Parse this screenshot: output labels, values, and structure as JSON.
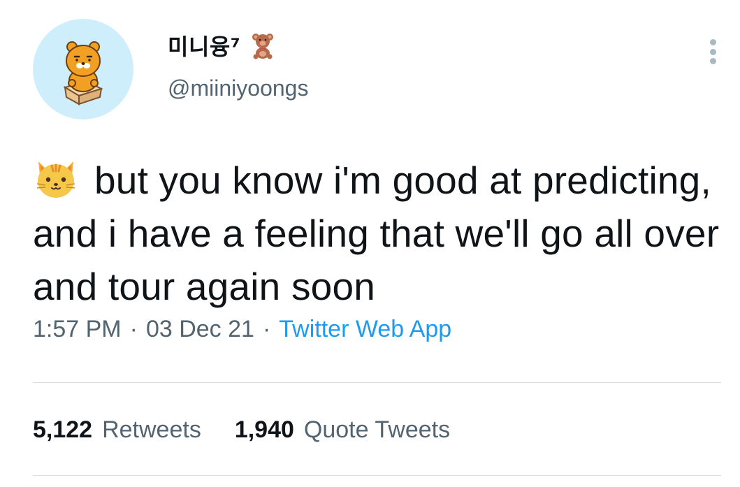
{
  "author": {
    "display_name": "미니융⁷",
    "badge_emoji": "teddy-bear",
    "handle": "@miiniyoongs",
    "avatar": "ryan-bear-character"
  },
  "tweet": {
    "leading_emoji": "cat-face",
    "text": "but you know i'm good at predicting, and i have a feeling that we'll go all over and tour again soon"
  },
  "meta": {
    "time": "1:57 PM",
    "separator": "·",
    "date": "03 Dec 21",
    "source": "Twitter Web App"
  },
  "stats": {
    "retweets_count": "5,122",
    "retweets_label": "Retweets",
    "quotes_count": "1,940",
    "quotes_label": "Quote Tweets"
  },
  "colors": {
    "text": "#0f1419",
    "secondary": "#536471",
    "link": "#1d9bf0",
    "avatar_bg": "#cfeefb",
    "divider": "#dcdfe2"
  }
}
